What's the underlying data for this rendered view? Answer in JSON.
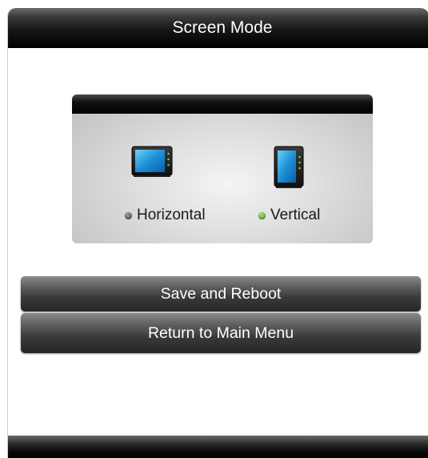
{
  "window": {
    "title": "Screen Mode"
  },
  "screen_mode": {
    "options": [
      {
        "label": "Horizontal",
        "icon": "tablet-landscape-icon",
        "selected": false
      },
      {
        "label": "Vertical",
        "icon": "tablet-portrait-icon",
        "selected": true
      }
    ]
  },
  "buttons": {
    "save_reboot": "Save and Reboot",
    "return_main": "Return to Main Menu"
  },
  "colors": {
    "selected_indicator": "#5aa82c",
    "unselected_indicator": "#5a5a5a",
    "screen_blue": "#1f8fd6"
  }
}
